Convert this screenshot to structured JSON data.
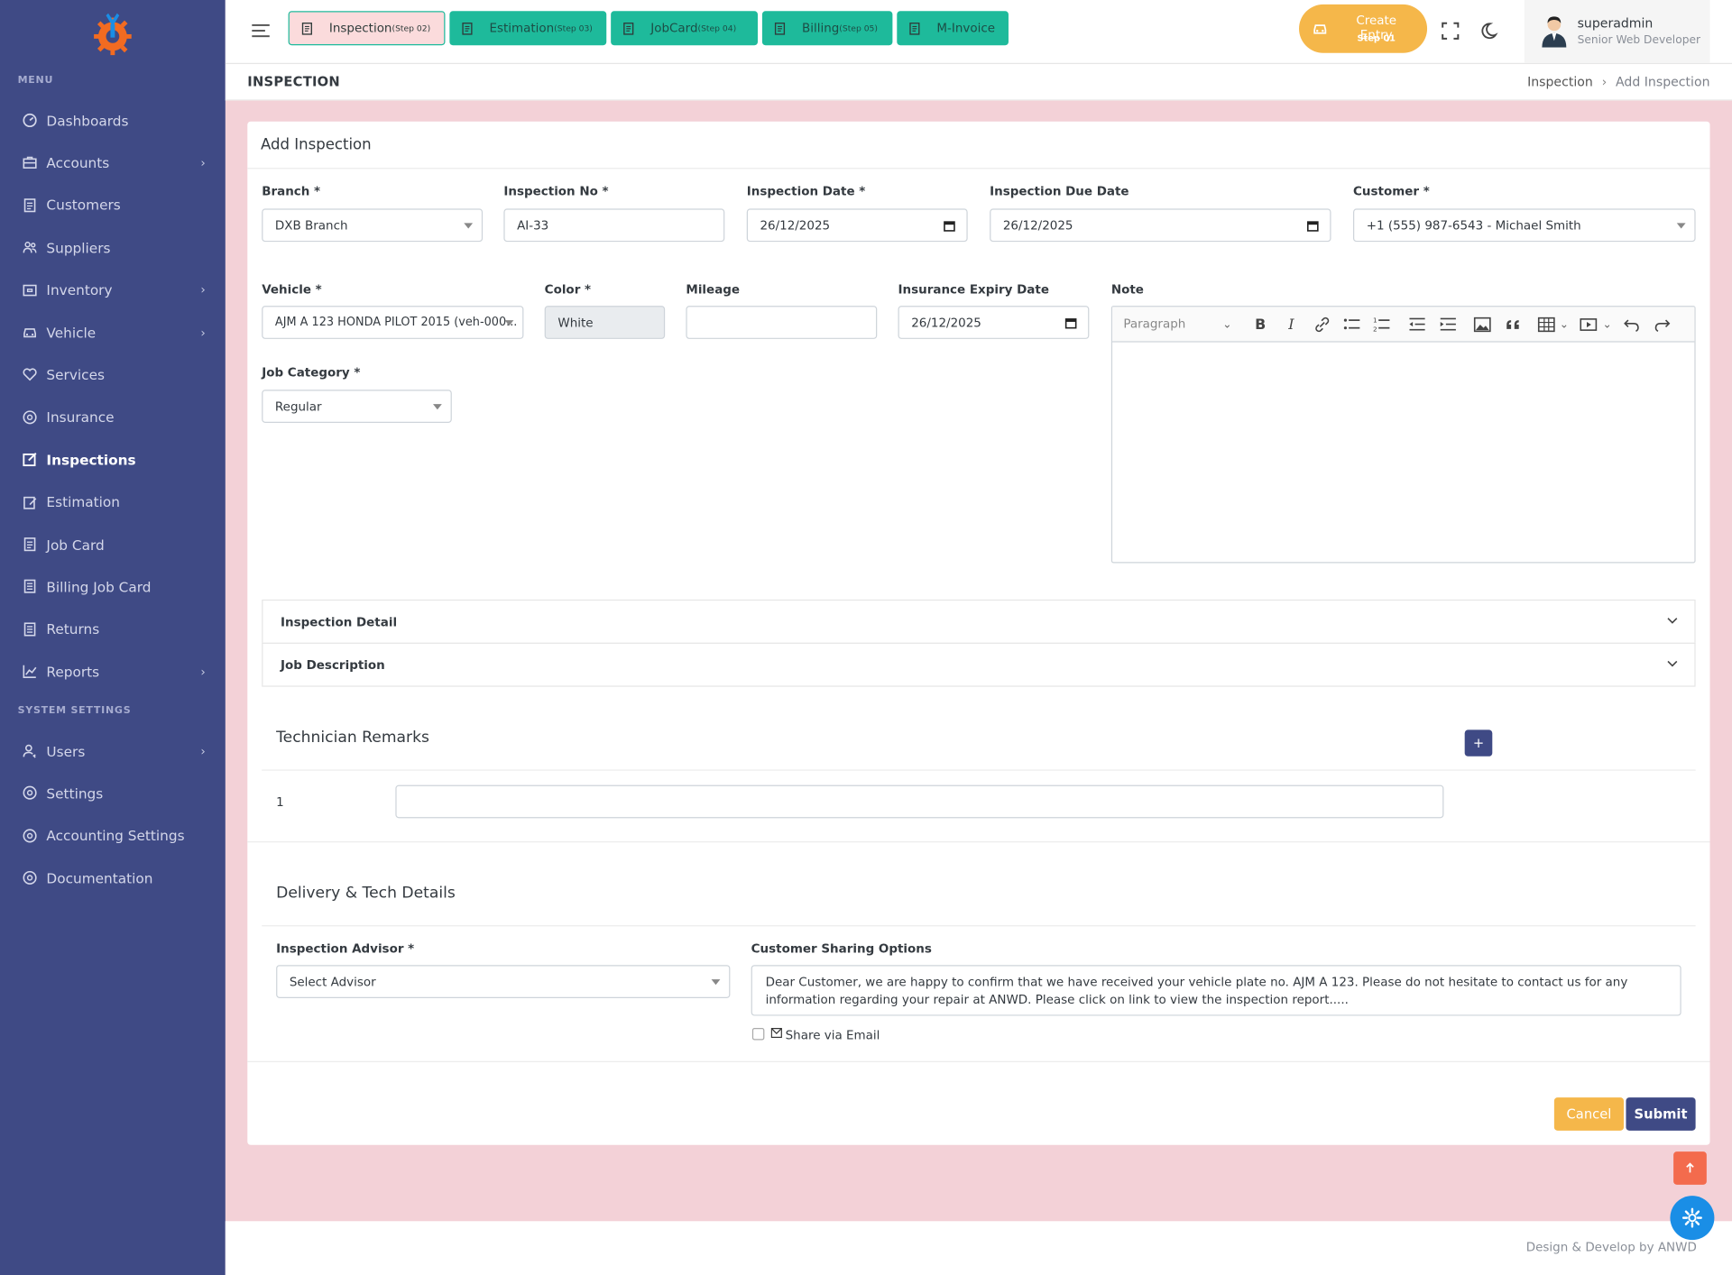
{
  "sidebar": {
    "menu_title": "MENU",
    "system_title": "SYSTEM SETTINGS",
    "items": [
      {
        "label": "Dashboards",
        "icon": "dashboard-icon",
        "chevron": false
      },
      {
        "label": "Accounts",
        "icon": "briefcase-icon",
        "chevron": true
      },
      {
        "label": "Customers",
        "icon": "file-icon",
        "chevron": false
      },
      {
        "label": "Suppliers",
        "icon": "users-icon",
        "chevron": false
      },
      {
        "label": "Inventory",
        "icon": "box-icon",
        "chevron": true
      },
      {
        "label": "Vehicle",
        "icon": "car-icon",
        "chevron": true
      },
      {
        "label": "Services",
        "icon": "heart-icon",
        "chevron": false
      },
      {
        "label": "Insurance",
        "icon": "shield-icon",
        "chevron": false
      },
      {
        "label": "Inspections",
        "icon": "edit-icon",
        "chevron": false,
        "active": true
      },
      {
        "label": "Estimation",
        "icon": "pencil-icon",
        "chevron": false
      },
      {
        "label": "Job Card",
        "icon": "document-icon",
        "chevron": false
      },
      {
        "label": "Billing Job Card",
        "icon": "list-icon",
        "chevron": false
      },
      {
        "label": "Returns",
        "icon": "list-icon",
        "chevron": false
      },
      {
        "label": "Reports",
        "icon": "chart-icon",
        "chevron": true
      }
    ],
    "system_items": [
      {
        "label": "Users",
        "icon": "user-icon",
        "chevron": true
      },
      {
        "label": "Settings",
        "icon": "gear-icon",
        "chevron": false
      },
      {
        "label": "Accounting Settings",
        "icon": "gear-icon",
        "chevron": false
      },
      {
        "label": "Documentation",
        "icon": "gear-icon",
        "chevron": false
      }
    ]
  },
  "topbar": {
    "steps": [
      {
        "label": "Inspection",
        "step": "(Step 02)",
        "style": "pink"
      },
      {
        "label": "Estimation",
        "step": "(Step 03)",
        "style": "teal"
      },
      {
        "label": "JobCard",
        "step": "(Step 04)",
        "style": "teal"
      },
      {
        "label": "Billing",
        "step": "(Step 05)",
        "style": "teal"
      },
      {
        "label": "M-Invoice",
        "step": "",
        "style": "teal"
      }
    ],
    "create_entry": {
      "label": "Create Entry",
      "step": "Step 01"
    },
    "user": {
      "name": "superadmin",
      "role": "Senior Web Developer"
    }
  },
  "page": {
    "title": "INSPECTION",
    "breadcrumb": [
      "Inspection",
      "Add Inspection"
    ]
  },
  "form": {
    "heading": "Add Inspection",
    "branch": {
      "label": "Branch *",
      "value": "DXB Branch"
    },
    "inspection_no": {
      "label": "Inspection No *",
      "value": "AI-33"
    },
    "inspection_date": {
      "label": "Inspection Date *",
      "value": "26/12/2025"
    },
    "due_date": {
      "label": "Inspection Due Date",
      "value": "26/12/2025"
    },
    "customer": {
      "label": "Customer *",
      "value": "+1 (555) 987-6543 - Michael Smith"
    },
    "vehicle": {
      "label": "Vehicle *",
      "value": "AJM A 123 HONDA PILOT 2015 (veh-000..."
    },
    "color": {
      "label": "Color *",
      "value": "White"
    },
    "mileage": {
      "label": "Mileage",
      "value": ""
    },
    "insurance_expiry": {
      "label": "Insurance Expiry Date",
      "value": "26/12/2025"
    },
    "note": {
      "label": "Note",
      "paragraph": "Paragraph"
    },
    "job_category": {
      "label": "Job Category *",
      "value": "Regular"
    },
    "accordions": [
      "Inspection Detail",
      "Job Description"
    ],
    "tech_remarks": {
      "heading": "Technician Remarks",
      "row_no": "1",
      "add": "+"
    },
    "delivery": {
      "heading": "Delivery & Tech Details",
      "advisor_label": "Inspection Advisor *",
      "advisor_value": "Select Advisor",
      "sharing_label": "Customer Sharing Options",
      "sharing_text": "Dear Customer, we are happy to confirm that we have received your vehicle plate no. AJM A 123. Please do not hesitate to contact us for any information regarding your repair at ANWD. Please click on link to view the inspection report.....",
      "share_email": "Share via Email"
    },
    "cancel": "Cancel",
    "submit": "Submit"
  },
  "footer": {
    "text": "Design & Develop by ANWD"
  },
  "colors": {
    "sidebar": "#3f4a85",
    "teal": "#1eba9b",
    "accent": "#f5b74a",
    "background": "#f3d1d7"
  }
}
